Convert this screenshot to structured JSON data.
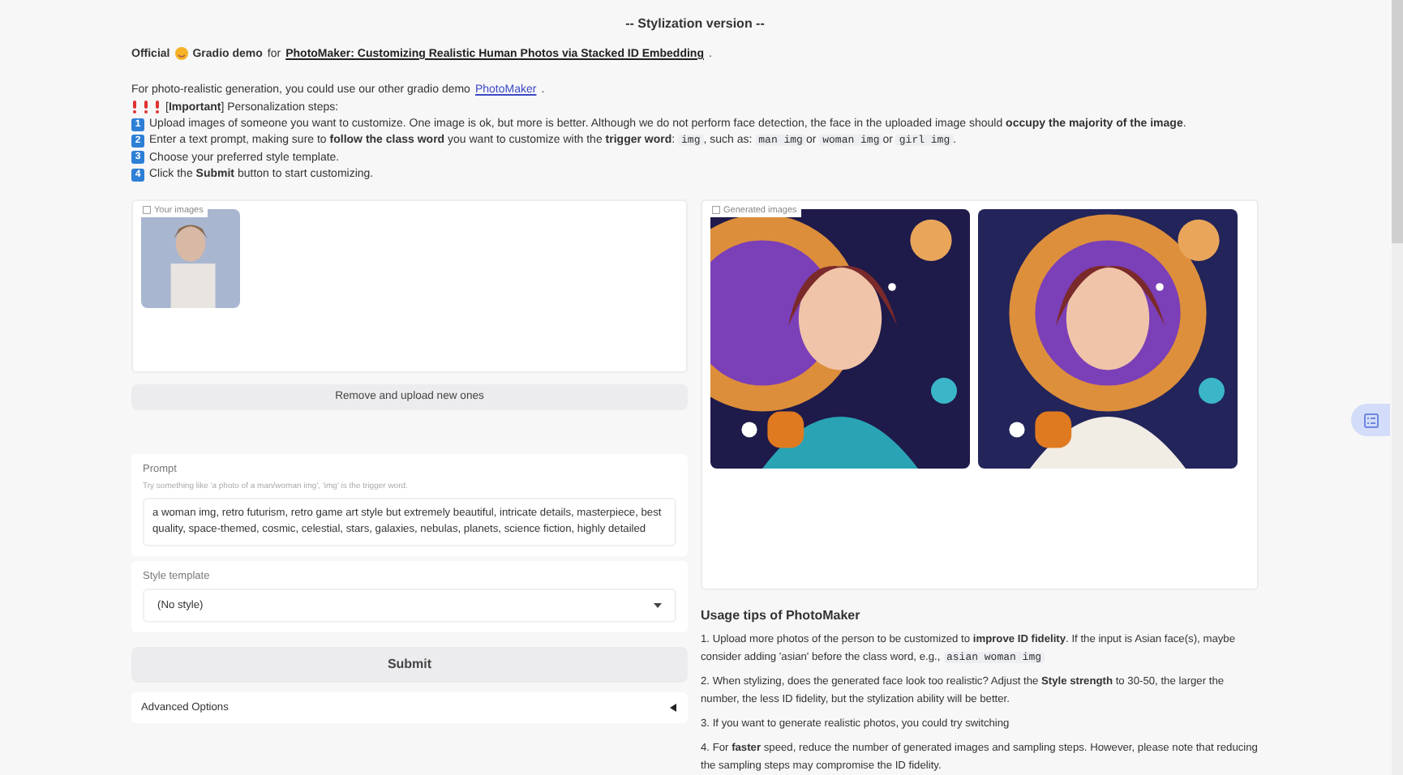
{
  "header": {
    "title": "-- Stylization version --",
    "official": {
      "before": "Official",
      "after": "Gradio demo",
      "for": "for",
      "link": "PhotoMaker: Customizing Realistic Human Photos via Stacked ID Embedding",
      "end": "."
    },
    "other": {
      "text": "For photo-realistic generation, you could use our other gradio demo",
      "link": "PhotoMaker",
      "end": "."
    },
    "important": "[**Important**] Personalization steps:",
    "steps": [
      {
        "num": "1",
        "parts": [
          {
            "kind": "text",
            "text": "Upload images of someone you want to customize. One image is ok, but more is better. Although we do not perform face detection, the face in the uploaded image should **occupy the majority of the image**."
          }
        ]
      },
      {
        "num": "2",
        "parts": [
          {
            "kind": "text",
            "text": "Enter a text prompt, making sure to **follow the class word** you want to customize with the **trigger word**:"
          },
          {
            "kind": "code",
            "text": "img"
          },
          {
            "kind": "text",
            "text": ", such as:"
          },
          {
            "kind": "code",
            "text": "man img"
          },
          {
            "kind": "text",
            "text": "or"
          },
          {
            "kind": "code",
            "text": "woman img"
          },
          {
            "kind": "text",
            "text": "or"
          },
          {
            "kind": "code",
            "text": "girl img"
          },
          {
            "kind": "text",
            "text": "."
          }
        ]
      },
      {
        "num": "3",
        "parts": [
          {
            "kind": "text",
            "text": "Choose your preferred style template."
          }
        ]
      },
      {
        "num": "4",
        "parts": [
          {
            "kind": "text",
            "text": "Click the **Submit** button to start customizing."
          }
        ]
      }
    ]
  },
  "upload": {
    "label": "Your images",
    "button": "Remove and upload new ones"
  },
  "prompt": {
    "label": "Prompt",
    "info": "Try something like 'a photo of a man/woman img', 'img' is the trigger word.",
    "value": "a woman img, retro futurism, retro game art style but extremely beautiful, intricate details, masterpiece, best quality, space-themed, cosmic, celestial, stars, galaxies, nebulas, planets, science fiction, highly detailed"
  },
  "style": {
    "label": "Style template",
    "value": "(No style)"
  },
  "submit": "Submit",
  "advanced": {
    "label": "Advanced Options",
    "expanded": false
  },
  "gallery": {
    "label": "Generated images"
  },
  "tips": {
    "title": "Usage tips of PhotoMaker",
    "items": [
      {
        "parts": [
          {
            "kind": "text",
            "text": "1. Upload more photos of the person to be customized to **improve ID fidelity**. If the input is Asian face(s), maybe consider adding 'asian' before the class word, e.g.,"
          },
          {
            "kind": "code",
            "text": "asian woman img"
          }
        ]
      },
      {
        "parts": [
          {
            "kind": "text",
            "text": "2. When stylizing, does the generated face look too realistic? Adjust the **Style strength** to 30-50, the larger the number, the less ID fidelity, but the stylization ability will be better."
          }
        ]
      },
      {
        "parts": [
          {
            "kind": "text",
            "text": "3. If you want to generate realistic photos, you could try switching"
          }
        ]
      },
      {
        "parts": [
          {
            "kind": "text",
            "text": "4. For **faster** speed, reduce the number of generated images and sampling steps. However, please note that reducing the sampling steps may compromise the ID fidelity."
          }
        ]
      }
    ]
  }
}
